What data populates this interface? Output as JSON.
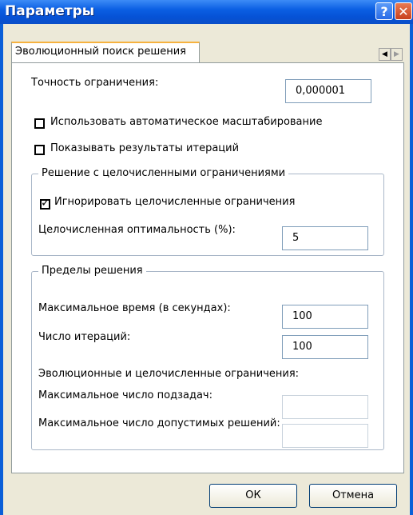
{
  "window": {
    "title": "Параметры",
    "help": "?",
    "close": "✕"
  },
  "tab": {
    "label": "Эволюционный поиск решения"
  },
  "fields": {
    "precision_label": "Точность ограничения:",
    "precision_value": "0,000001",
    "auto_scale_label": "Использовать автоматическое масштабирование",
    "show_iterations_label": "Показывать результаты итераций"
  },
  "integer_group": {
    "legend": "Решение с целочисленными ограничениями",
    "ignore_label": "Игнорировать целочисленные ограничения",
    "ignore_checked": true,
    "optimality_label": "Целочисленная оптимальность (%):",
    "optimality_value": "5"
  },
  "limits_group": {
    "legend": "Пределы решения",
    "max_time_label": "Максимальное время (в секундах):",
    "max_time_value": "100",
    "iterations_label": "Число итераций:",
    "iterations_value": "100",
    "evo_heading": "Эволюционные и целочисленные ограничения:",
    "max_subproblems_label": "Максимальное число подзадач:",
    "max_subproblems_value": "",
    "max_feasible_label": "Максимальное число допустимых решений:",
    "max_feasible_value": ""
  },
  "buttons": {
    "ok": "ОК",
    "cancel": "Отмена"
  }
}
